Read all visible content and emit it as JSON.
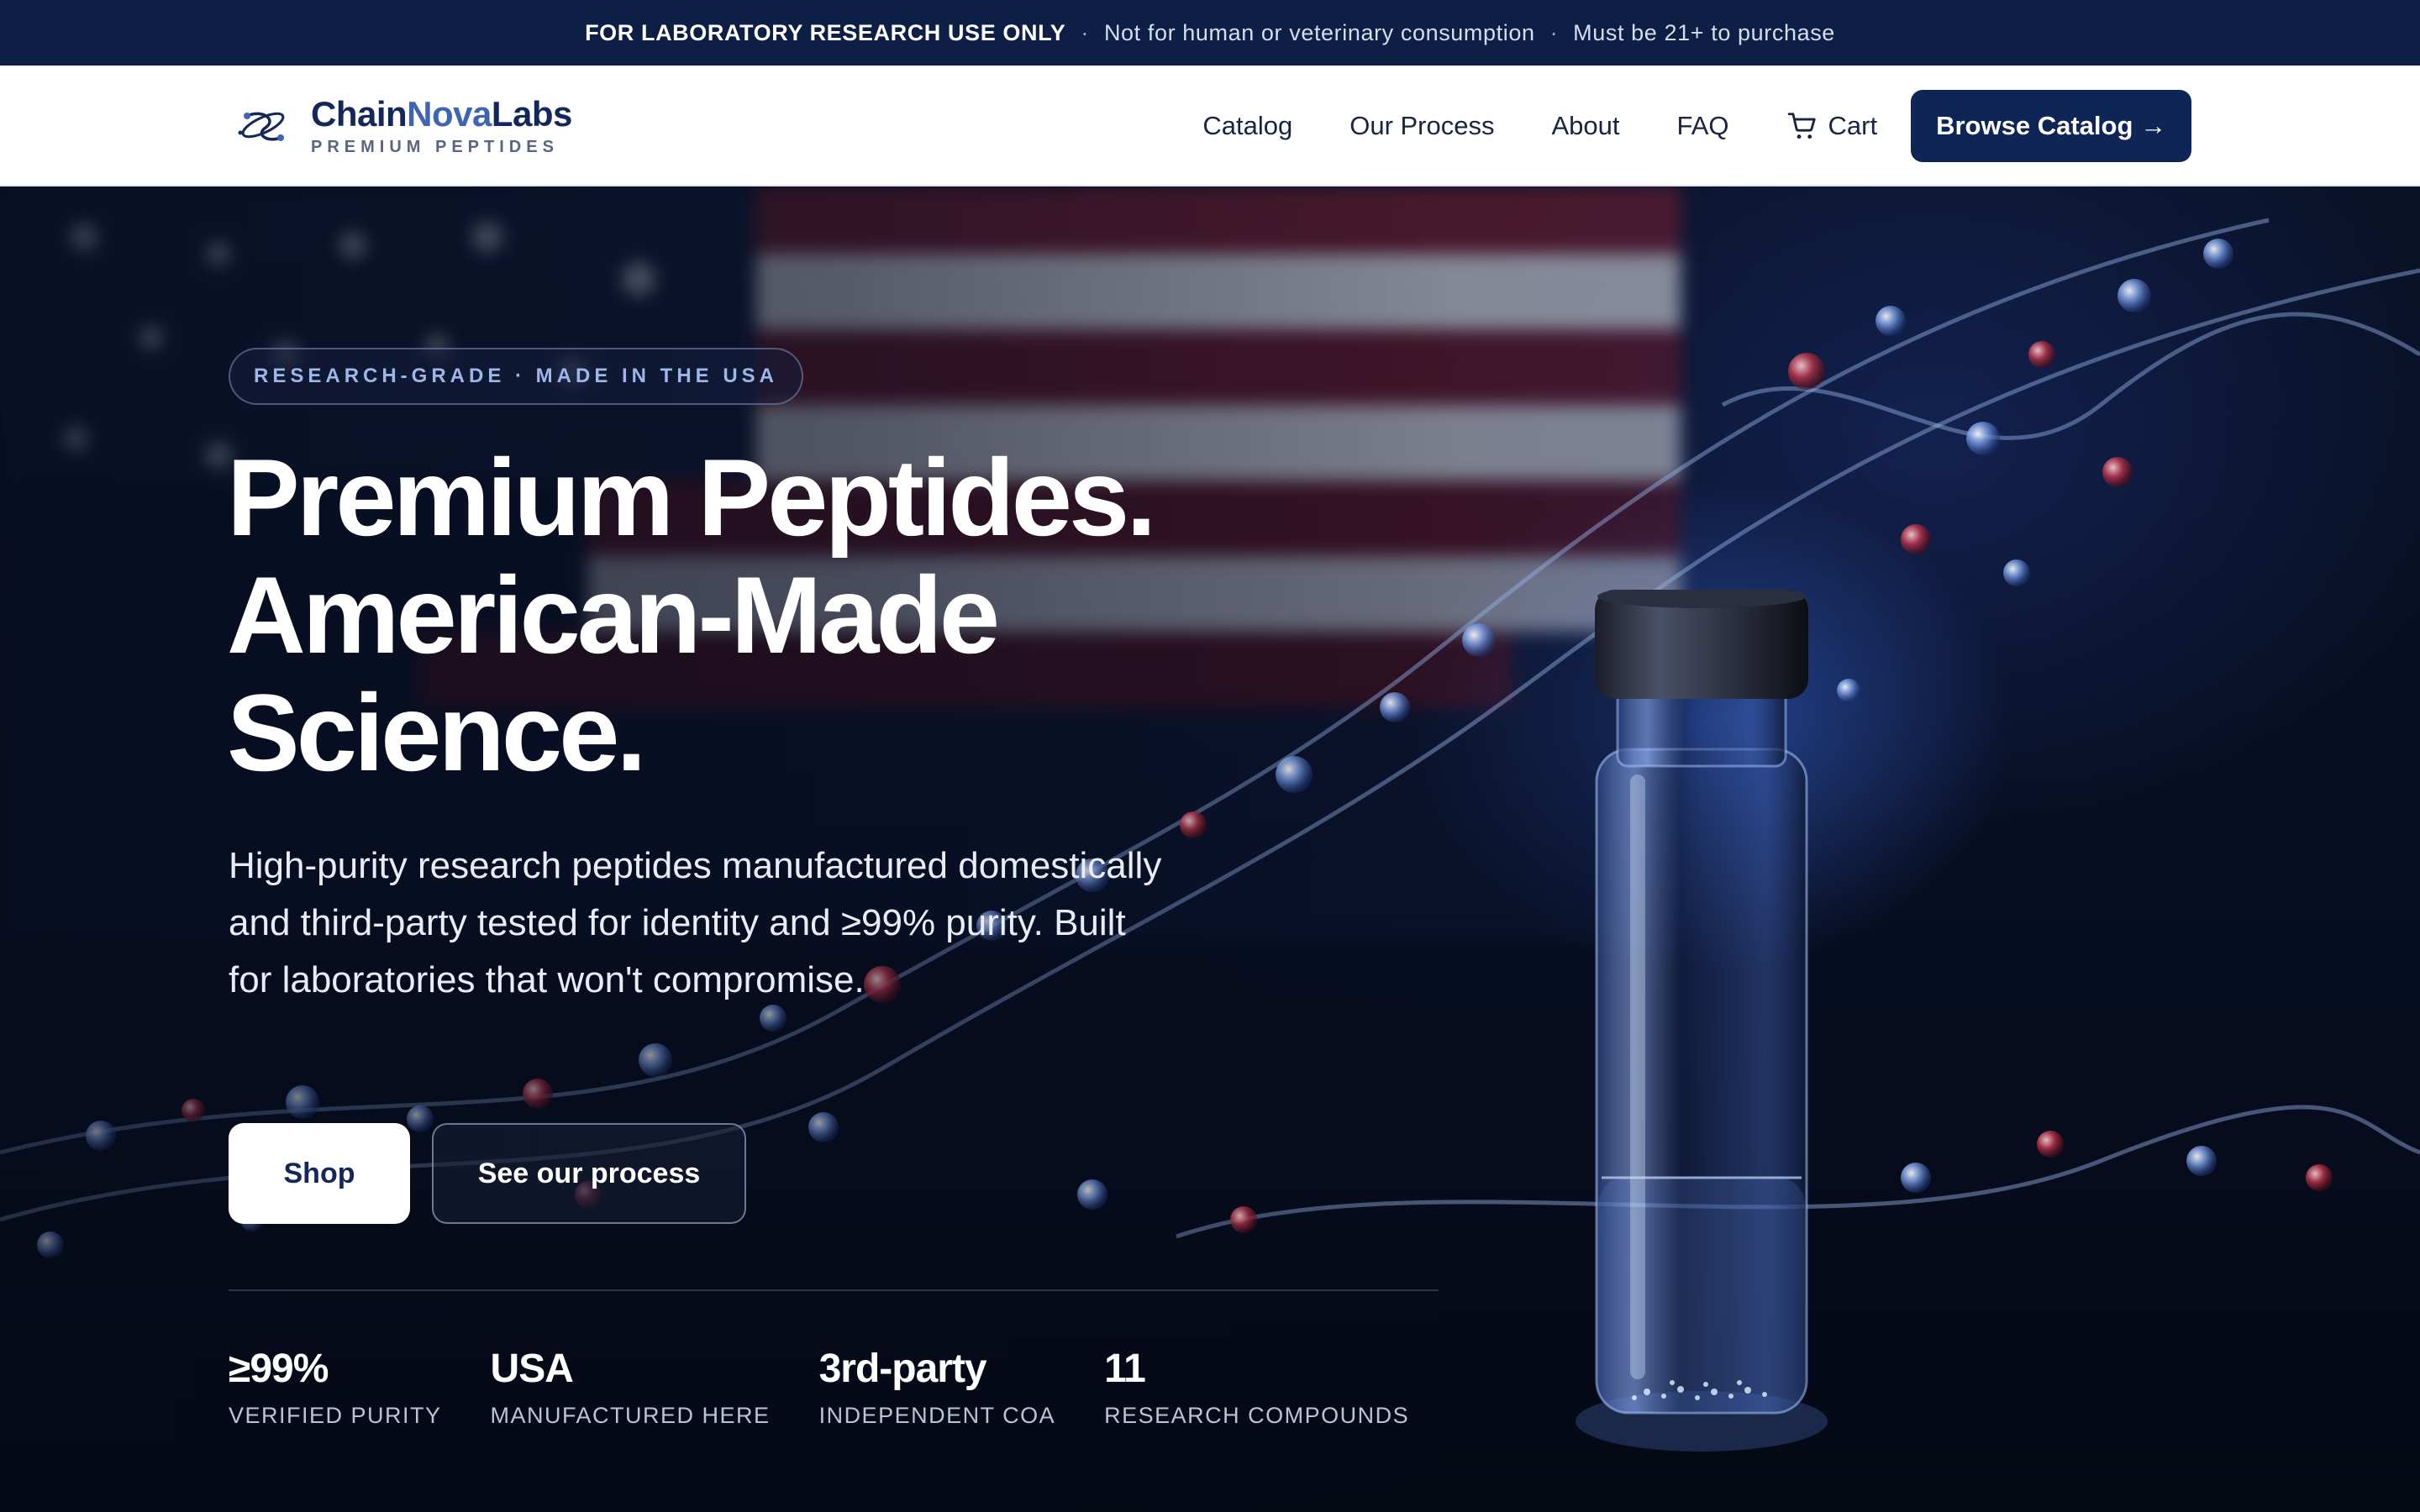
{
  "announcement": {
    "strong": "FOR LABORATORY RESEARCH USE ONLY",
    "separator": "·",
    "note1": "Not for human or veterinary consumption",
    "note2": "Must be 21+ to purchase"
  },
  "brand": {
    "name_part1": "Chain",
    "name_part2": "Nova",
    "name_part3": "Labs",
    "tagline": "PREMIUM PEPTIDES",
    "logo_icon": "molecule-logo-icon"
  },
  "nav": {
    "links": [
      "Catalog",
      "Our Process",
      "About",
      "FAQ"
    ],
    "cart_label": "Cart",
    "cart_icon": "cart-icon",
    "cta_label": "Browse Catalog →"
  },
  "hero": {
    "badge": "RESEARCH-GRADE · MADE IN THE USA",
    "headline": [
      "Premium Peptides.",
      "American-Made",
      "Science."
    ],
    "lead": "High-purity research peptides manufactured domestically and third-party tested for identity and ≥99% purity. Built for laboratories that won't compromise.",
    "primary_button": "Shop",
    "secondary_button": "See our process"
  },
  "stats": [
    {
      "value": "≥99%",
      "label": "VERIFIED PURITY"
    },
    {
      "value": "USA",
      "label": "MANUFACTURED HERE"
    },
    {
      "value": "3rd-party",
      "label": "INDEPENDENT COA"
    },
    {
      "value": "11",
      "label": "RESEARCH COMPOUNDS"
    }
  ],
  "colors": {
    "navy": "#0d1f44",
    "brand_blue": "#3f63b5",
    "button_dark": "#0f2556"
  }
}
